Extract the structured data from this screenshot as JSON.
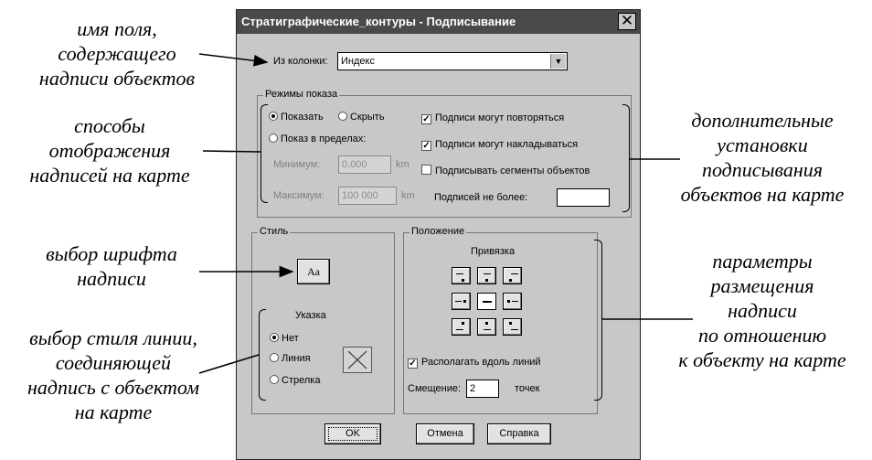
{
  "annotations": {
    "field_name": [
      "имя поля,",
      "содержащего",
      "надписи объектов"
    ],
    "display_methods": [
      "способы",
      "отображения",
      "надписей на карте"
    ],
    "font_choice": [
      "выбор шрифта",
      "надписи"
    ],
    "line_style": [
      "выбор стиля линии,",
      "соединяющей",
      "надпись с объектом",
      "на карте"
    ],
    "extra_settings": [
      "дополнительные",
      "установки",
      "подписывания",
      "объектов на карте"
    ],
    "placement_params": [
      "параметры",
      "размещения",
      "надписи",
      "по отношению",
      "к объекту на карте"
    ]
  },
  "dialog": {
    "title": "Стратиграфические_контуры - Подписывание",
    "close_glyph": "✕",
    "column_label": "Из колонки:",
    "column_value": "Индекс",
    "modes_group": "Режимы показа",
    "show": "Показать",
    "hide": "Скрыть",
    "show_in_range": "Показ в пределах:",
    "min_label": "Минимум:",
    "min_value": "0,000",
    "max_label": "Максимум:",
    "max_value": "100 000",
    "unit": "km",
    "repeat_check": "Подписи могут повторяться",
    "overlap_check": "Подписи могут накладываться",
    "segments_check": "Подписывать сегменты объектов",
    "max_count_label": "Подписей не более:",
    "max_count_value": "",
    "style_group": "Стиль",
    "font_button": "Аа",
    "pointer_label": "Указка",
    "pointer_none": "Нет",
    "pointer_line": "Линия",
    "pointer_arrow": "Стрелка",
    "position_group": "Положение",
    "anchor_label": "Привязка",
    "along_lines": "Располагать вдоль линий",
    "offset_label": "Смещение:",
    "offset_value": "2",
    "offset_unit": "точек",
    "ok": "OK",
    "cancel": "Отмена",
    "help": "Справка",
    "state": {
      "mode": "Показать",
      "pointer": "Нет",
      "repeat": true,
      "overlap": true,
      "segments": false,
      "along_lines": true
    }
  }
}
